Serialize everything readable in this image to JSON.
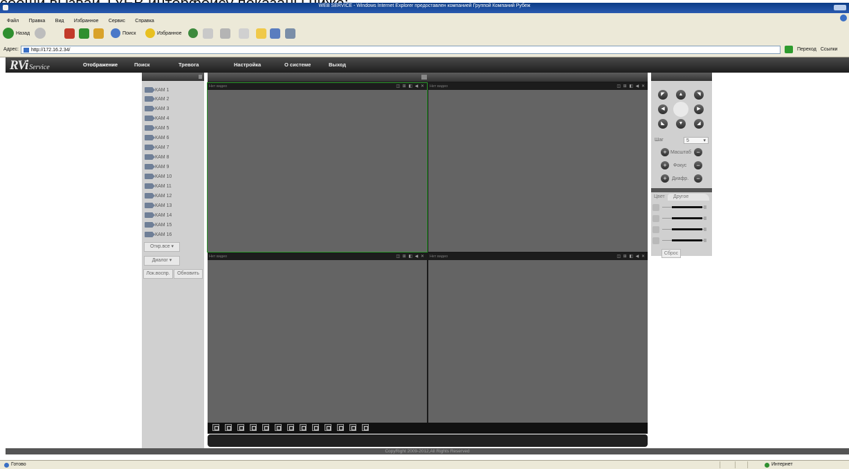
{
  "caption": "сеоши вызвай ТУЕВ интерфейсу показаны ниже:",
  "ie": {
    "title": "WEB SERVICE - Windows Internet Explorer предоставлен компанией Группой Компаний Рубеж",
    "menu": [
      "Файл",
      "Правка",
      "Вид",
      "Избранное",
      "Сервис",
      "Справка"
    ],
    "back_label": "Назад",
    "search_label": "Поиск",
    "favorites_label": "Избранное",
    "address_label": "Адрес:",
    "address_value": "http://172.16.2.34/",
    "go_label": "Переход",
    "links_label": "Ссылки",
    "status_left": "Готово",
    "status_right": "Интернет"
  },
  "app": {
    "logo_main": "RVi",
    "logo_sub": "Service",
    "nav": [
      "Отображение",
      "Поиск",
      "Тревога",
      "Настройка",
      "О системе",
      "Выход"
    ]
  },
  "cameras": [
    "КАМ 1",
    "КАМ 2",
    "КАМ 3",
    "КАМ 4",
    "КАМ 5",
    "КАМ 6",
    "КАМ 7",
    "КАМ 8",
    "КАМ 9",
    "КАМ 10",
    "КАМ 11",
    "КАМ 12",
    "КАМ 13",
    "КАМ 14",
    "КАМ 15",
    "КАМ 16"
  ],
  "panel": {
    "open_all": "Откр.все",
    "dialog": "Диалог",
    "local_play": "Лок.воспр.",
    "refresh": "Обновить"
  },
  "video": {
    "no_video": "Нет видео",
    "cell_icons": "◫ ⊞ ◧ ◀ ✕"
  },
  "ptz": {
    "step_label": "Шаг",
    "step_value": "5",
    "zoom_label": "Масштаб",
    "focus_label": "Фокус",
    "iris_label": "Диафр."
  },
  "color": {
    "tab1": "Цвет",
    "tab2": "Другое",
    "reset": "Сброс"
  },
  "footer": {
    "copyright": "CopyRight 2009-2012,All Rights Reserved"
  }
}
